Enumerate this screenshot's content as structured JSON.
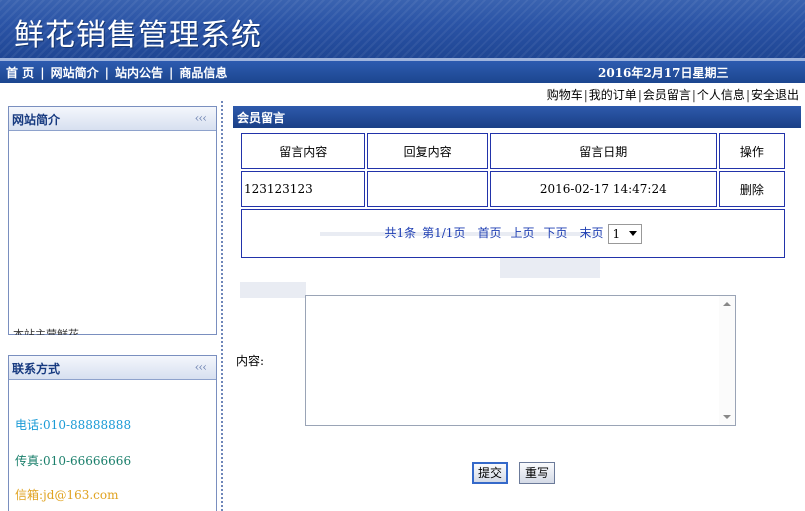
{
  "header": {
    "title": "鲜花销售管理系统"
  },
  "nav": {
    "items": [
      "首 页",
      "网站简介",
      "站内公告",
      "商品信息"
    ],
    "separator": "|",
    "date": "2016年2月17日星期三"
  },
  "user_links": {
    "items": [
      "购物车",
      "我的订单",
      "会员留言",
      "个人信息",
      "安全退出"
    ],
    "separator": "|"
  },
  "sidebar": {
    "intro": {
      "title": "网站简介",
      "collapse_icon": "‹‹‹",
      "truncated_text": "本站主营鲜花"
    },
    "contact": {
      "title": "联系方式",
      "collapse_icon": "‹‹‹",
      "phone": "电话:010-88888888",
      "fax": "传真:010-66666666",
      "email": "信箱:jd@163.com"
    }
  },
  "main": {
    "title": "会员留言",
    "table": {
      "headers": [
        "留言内容",
        "回复内容",
        "留言日期",
        "操作"
      ],
      "rows": [
        {
          "content": "123123123",
          "reply": "",
          "date": "2016-02-17 14:47:24",
          "action": "删除"
        }
      ]
    },
    "pager": {
      "total": "共1条",
      "page": "第1/1页",
      "first": "首页",
      "prev": "上页",
      "next": "下页",
      "last": "末页",
      "selected": "1"
    },
    "form": {
      "content_label": "内容:",
      "content_value": "",
      "submit_label": "提交",
      "reset_label": "重写"
    }
  },
  "colors": {
    "banner": "#2b54a6",
    "table_border": "#2233aa",
    "pager_link": "#1f3fb3",
    "phone": "#1a9ad6",
    "fax": "#1a7f6b",
    "email": "#e0a321"
  }
}
